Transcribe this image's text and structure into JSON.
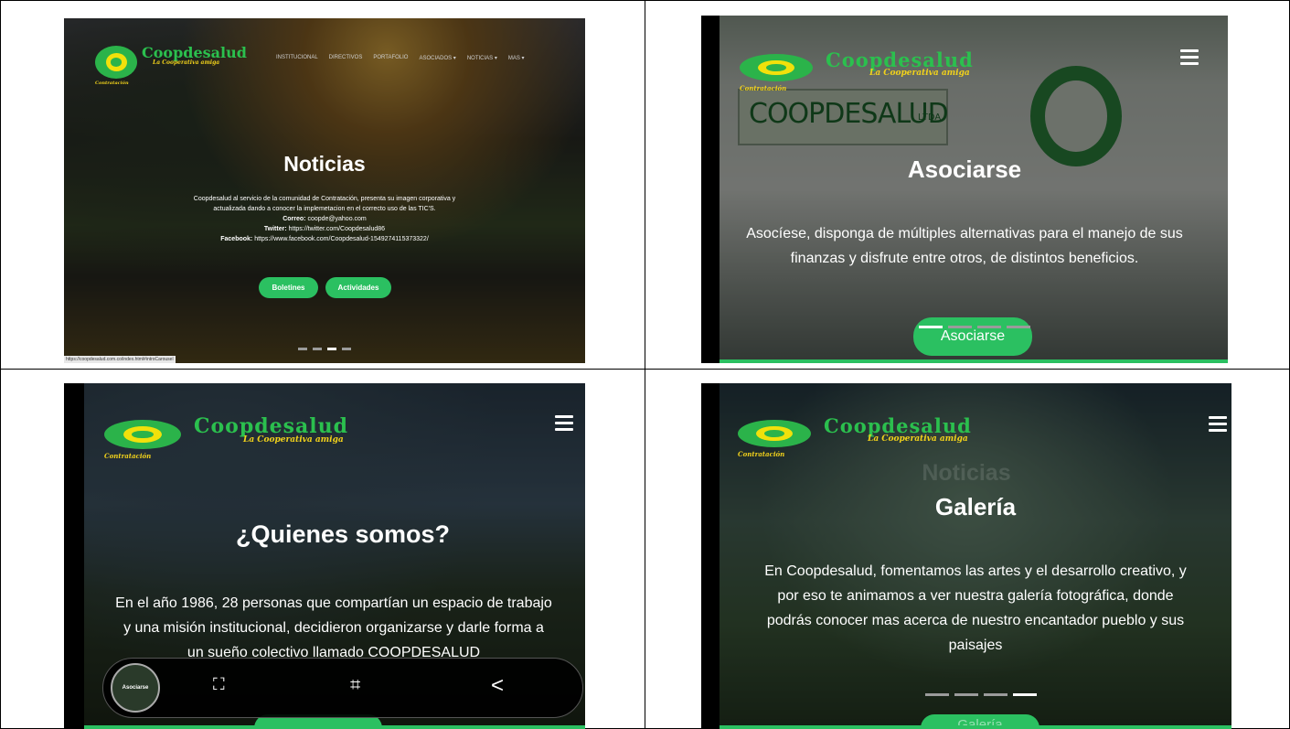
{
  "colors": {
    "brand_green": "#2bc061",
    "logo_yellow": "#f2d21b"
  },
  "logo": {
    "name": "Coopdesalud",
    "tagline": "La Cooperativa amiga",
    "sub": "Contratación"
  },
  "panel1": {
    "nav": [
      "INSTITUCIONAL",
      "DIRECTIVOS",
      "PORTAFOLIO",
      "ASOCIADOS ▾",
      "NOTICIAS ▾",
      "MAS ▾"
    ],
    "title": "Noticias",
    "lines": [
      "Coopdesalud al servicio de la comunidad de Contratación, presenta su imagen corporativa y",
      "actualizada dando a conocer la implemetacion en el correcto uso de las TIC'S."
    ],
    "email_label": "Correo:",
    "email": "coopde@yahoo.com",
    "twitter_label": "Twitter:",
    "twitter": "https://twitter.com/Coopdesalud86",
    "facebook_label": "Facebook:",
    "facebook": "https://www.facebook.com/Coopdesalud-1549274115373322/",
    "btn1": "Boletines",
    "btn2": "Actividades",
    "status_url": "https://coopdesalud.com.co/index.html#introCarousel"
  },
  "panel2": {
    "sign": "COOPDESALUD",
    "sign_suffix": "LTDA",
    "title": "Asociarse",
    "lines": [
      "Asocíese, disponga de múltiples alternativas para el manejo de sus",
      "finanzas y disfrute entre otros, de distintos beneficios."
    ],
    "btn": "Asociarse"
  },
  "panel3": {
    "title": "¿Quienes somos?",
    "lines": [
      "En el año 1986, 28 personas que compartían un espacio de trabajo",
      "y una misión institucional, decidieron organizarse y darle forma a",
      "un sueño colectivo llamado COOPDESALUD"
    ],
    "thumb_title": "Asociarse",
    "toolbar_icons": [
      "scroll-capture-icon",
      "crop-edit-icon",
      "share-icon"
    ]
  },
  "panel4": {
    "ghost_title": "Noticias",
    "title": "Galería",
    "lines": [
      "En Coopdesalud, fomentamos las artes y el desarrollo creativo, y",
      "por eso te animamos a ver nuestra galería fotográfica, donde",
      "podrás conocer mas acerca de nuestro encantador pueblo y sus",
      "paisajes"
    ],
    "btn": "Galería"
  }
}
